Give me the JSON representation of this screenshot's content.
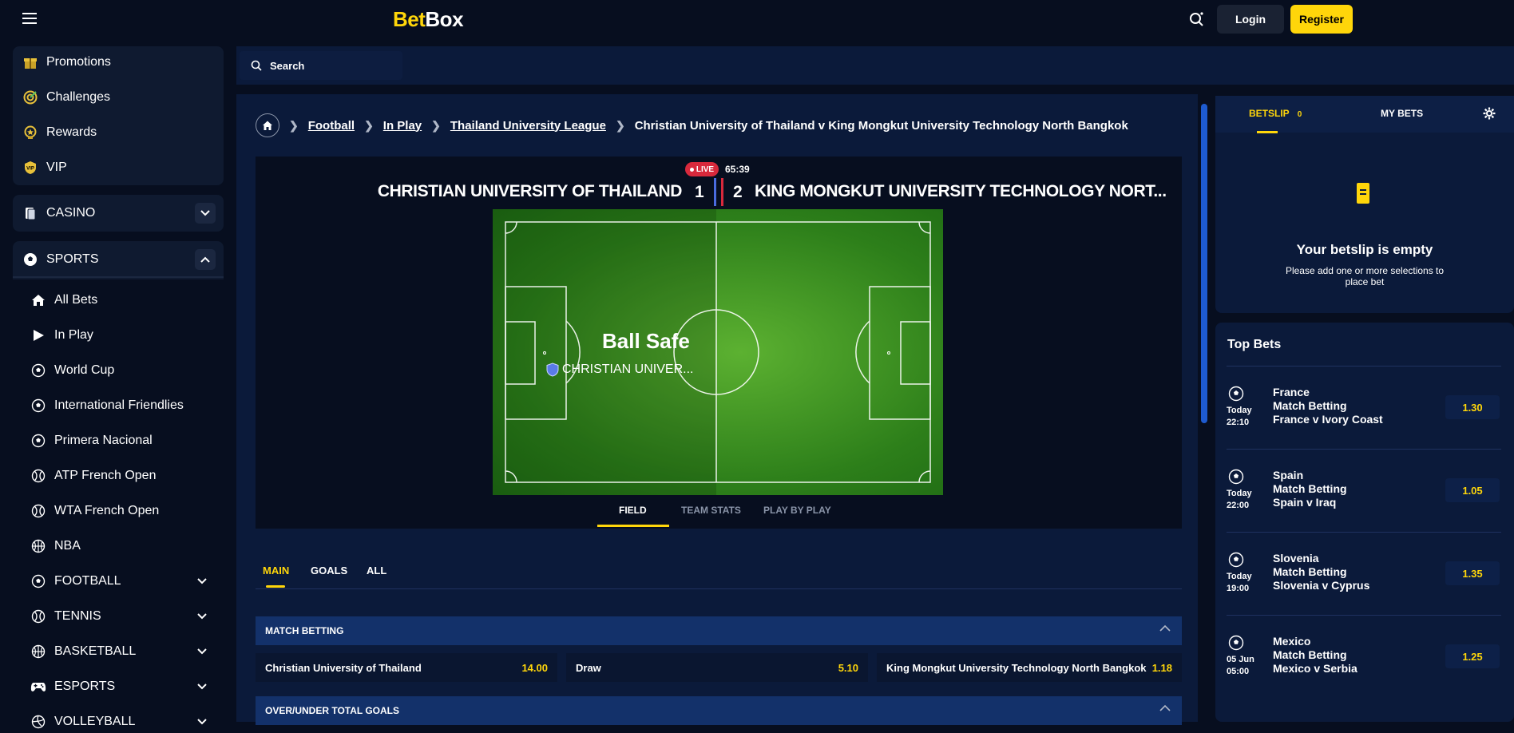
{
  "header": {
    "logo_part1": "Bet",
    "logo_part2": "Box",
    "login": "Login",
    "register": "Register"
  },
  "search": {
    "placeholder": "Search"
  },
  "sidebar": {
    "top_items": [
      {
        "label": "Promotions",
        "icon": "gift-icon"
      },
      {
        "label": "Challenges",
        "icon": "target-icon"
      },
      {
        "label": "Rewards",
        "icon": "medal-icon"
      },
      {
        "label": "VIP",
        "icon": "vip-shield-icon"
      }
    ],
    "casino": "CASINO",
    "sports": "SPORTS",
    "sports_items": [
      {
        "label": "All Bets",
        "icon": "house-icon"
      },
      {
        "label": "In Play",
        "icon": "play-icon"
      },
      {
        "label": "World Cup",
        "icon": "football-icon"
      },
      {
        "label": "International Friendlies",
        "icon": "football-icon"
      },
      {
        "label": "Primera Nacional",
        "icon": "football-icon"
      },
      {
        "label": "ATP French Open",
        "icon": "tennis-icon"
      },
      {
        "label": "WTA French Open",
        "icon": "tennis-icon"
      },
      {
        "label": "NBA",
        "icon": "basketball-icon"
      },
      {
        "label": "FOOTBALL",
        "icon": "football-icon"
      },
      {
        "label": "TENNIS",
        "icon": "tennis-icon"
      },
      {
        "label": "BASKETBALL",
        "icon": "basketball-icon"
      },
      {
        "label": "ESPORTS",
        "icon": "gamepad-icon"
      },
      {
        "label": "VOLLEYBALL",
        "icon": "volleyball-icon"
      }
    ]
  },
  "breadcrumb": {
    "items": [
      "Football",
      "In Play",
      "Thailand University League"
    ],
    "current": "Christian University of Thailand v King Mongkut University Technology North Bangkok"
  },
  "match": {
    "live": "LIVE",
    "clock": "65:39",
    "home": "CHRISTIAN UNIVERSITY OF THAILAND",
    "home_score": "1",
    "away_score": "2",
    "away": "KING MONGKUT UNIVERSITY TECHNOLOGY NORT...",
    "status": "Ball Safe",
    "possession": "CHRISTIAN UNIVER...",
    "home_color": "#4a6be0",
    "away_color": "#d8293c",
    "tabs": [
      "FIELD",
      "TEAM STATS",
      "PLAY BY PLAY"
    ]
  },
  "bet_tabs": [
    "MAIN",
    "GOALS",
    "ALL"
  ],
  "markets": {
    "match_betting": "MATCH BETTING",
    "over_under": "OVER/UNDER TOTAL GOALS",
    "selections": [
      {
        "name": "Christian University of Thailand",
        "odds": "14.00"
      },
      {
        "name": "Draw",
        "odds": "5.10"
      },
      {
        "name": "King Mongkut University Technology North Bangkok",
        "odds": "1.18"
      }
    ]
  },
  "betslip": {
    "tab": "BETSLIP",
    "count": "0",
    "mybets": "MY BETS",
    "empty_title": "Your betslip is empty",
    "empty_sub": "Please add one or more selections to place bet"
  },
  "top_bets": {
    "title": "Top Bets",
    "items": [
      {
        "day": "Today",
        "time": "22:10",
        "team": "France",
        "market": "Match Betting",
        "event": "France v Ivory Coast",
        "odds": "1.30"
      },
      {
        "day": "Today",
        "time": "22:00",
        "team": "Spain",
        "market": "Match Betting",
        "event": "Spain v Iraq",
        "odds": "1.05"
      },
      {
        "day": "Today",
        "time": "19:00",
        "team": "Slovenia",
        "market": "Match Betting",
        "event": "Slovenia v Cyprus",
        "odds": "1.35"
      },
      {
        "day": "05 Jun",
        "time": "05:00",
        "team": "Mexico",
        "market": "Match Betting",
        "event": "Mexico v Serbia",
        "odds": "1.25"
      }
    ]
  }
}
